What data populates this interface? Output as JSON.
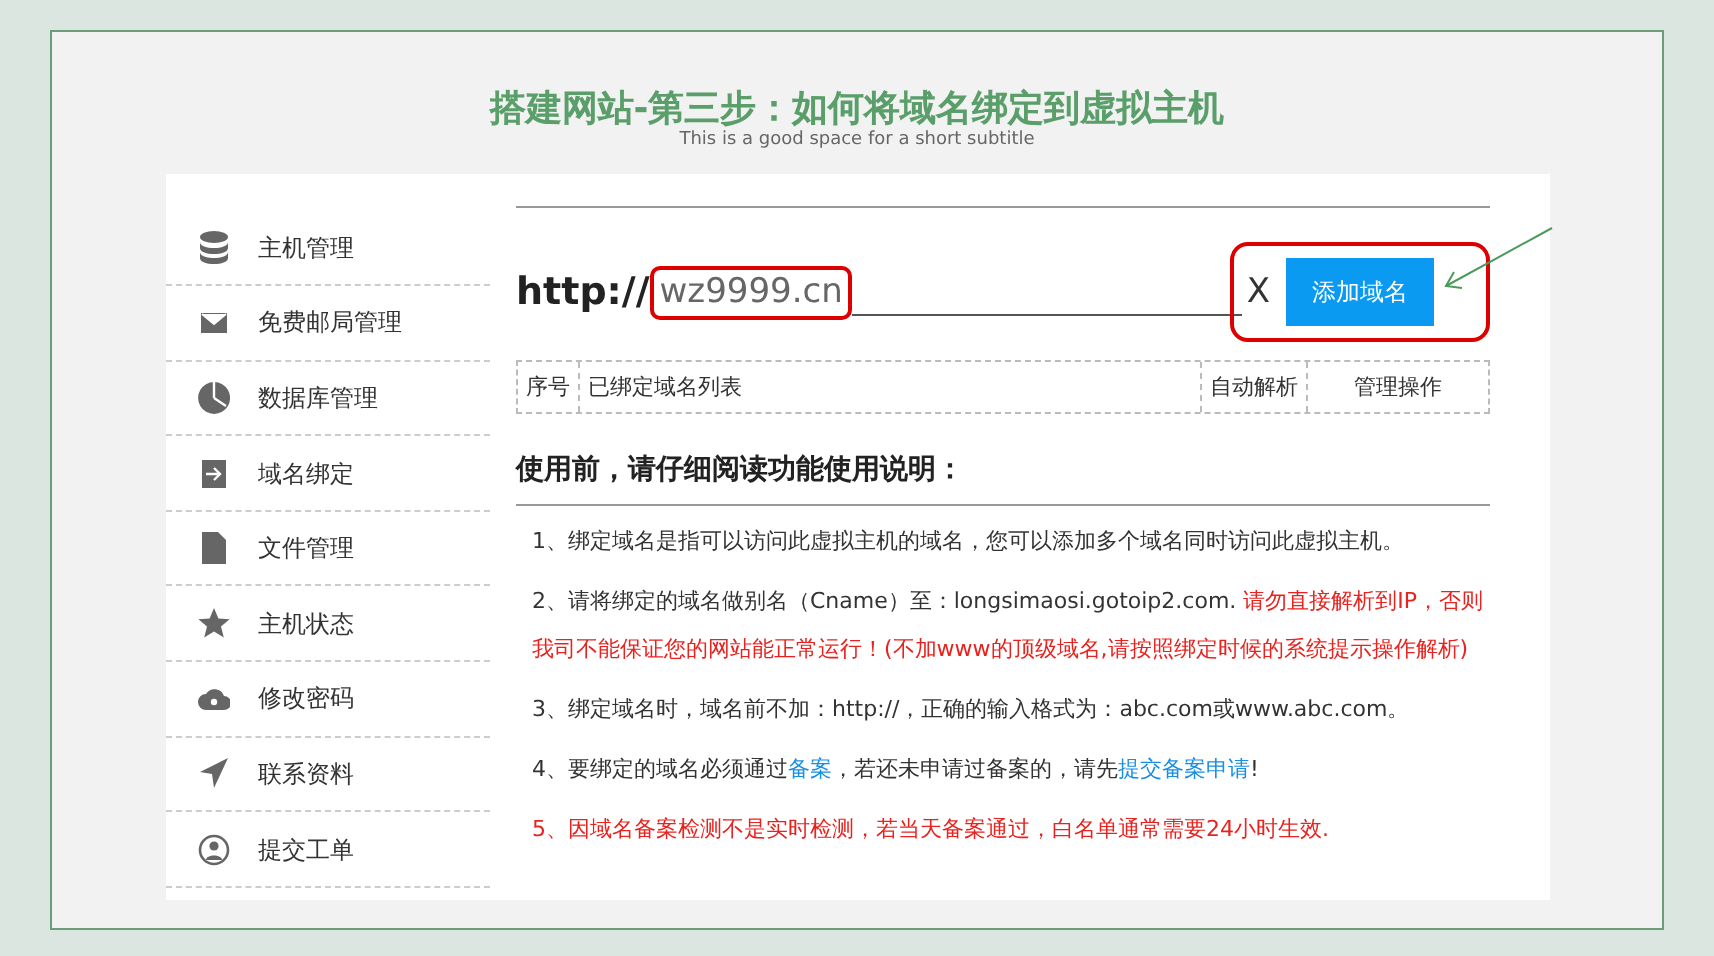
{
  "slide": {
    "title": "搭建网站-第三步：如何将域名绑定到虚拟主机",
    "subtitle": "This is a good space for a short subtitle"
  },
  "sidebar": {
    "items": [
      {
        "label": "主机管理"
      },
      {
        "label": "免费邮局管理"
      },
      {
        "label": "数据库管理"
      },
      {
        "label": "域名绑定"
      },
      {
        "label": "文件管理"
      },
      {
        "label": "主机状态"
      },
      {
        "label": "修改密码"
      },
      {
        "label": "联系资料"
      },
      {
        "label": "提交工单"
      }
    ]
  },
  "domain_form": {
    "prefix": "http://",
    "value": "wz9999.cn",
    "clear": "X",
    "button": "添加域名"
  },
  "table": {
    "columns": [
      "序号",
      "已绑定域名列表",
      "自动解析",
      "管理操作"
    ]
  },
  "instructions": {
    "heading": "使用前，请仔细阅读功能使用说明：",
    "items": [
      {
        "segments": [
          {
            "kind": "plain",
            "text": "1、绑定域名是指可以访问此虚拟主机的域名，您可以添加多个域名同时访问此虚拟主机。"
          }
        ]
      },
      {
        "segments": [
          {
            "kind": "plain",
            "text": "2、请将绑定的域名做别名（Cname）至：longsimaosi.gotoip2.com. "
          },
          {
            "kind": "warning",
            "text": "请勿直接解析到IP，否则我司不能保证您的网站能正常运行！(不加www的顶级域名,请按照绑定时候的系统提示操作解析)"
          }
        ]
      },
      {
        "segments": [
          {
            "kind": "plain",
            "text": "3、绑定域名时，域名前不加：http://，正确的输入格式为：abc.com或www.abc.com。"
          }
        ]
      },
      {
        "segments": [
          {
            "kind": "plain",
            "text": "4、要绑定的域名必须通过"
          },
          {
            "kind": "link",
            "text": "备案"
          },
          {
            "kind": "plain",
            "text": "，若还未申请过备案的，请先"
          },
          {
            "kind": "link",
            "text": "提交备案申请"
          },
          {
            "kind": "plain",
            "text": "!"
          }
        ]
      },
      {
        "segments": [
          {
            "kind": "warning",
            "text": "5、因域名备案检测不是实时检测，若当天备案通过，白名单通常需要24小时生效."
          }
        ]
      }
    ]
  }
}
